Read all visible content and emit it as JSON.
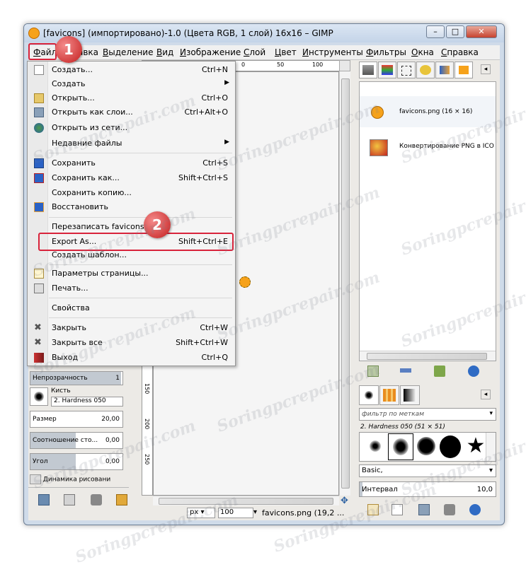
{
  "window": {
    "title": "[favicons] (импортировано)-1.0 (Цвета RGB, 1 слой) 16x16 – GIMP",
    "minimize": "–",
    "maximize": "□",
    "close": "✕"
  },
  "menubar": {
    "items": [
      {
        "label": "Файл",
        "u": "Ф",
        "rest": "айл"
      },
      {
        "label": "Правка",
        "u": "",
        "rest": "авка"
      },
      {
        "label": "Выделение",
        "u": "В",
        "rest": "ыделение"
      },
      {
        "label": "Вид",
        "u": "В",
        "rest": "ид"
      },
      {
        "label": "Изображение",
        "u": "И",
        "rest": "зображение"
      },
      {
        "label": "Слой",
        "u": "С",
        "rest": "лой"
      },
      {
        "label": "Цвет",
        "u": "Ц",
        "rest": "вет"
      },
      {
        "label": "Инструменты",
        "u": "И",
        "rest": "нструменты"
      },
      {
        "label": "Фильтры",
        "u": "Ф",
        "rest": "ильтры"
      },
      {
        "label": "Окна",
        "u": "О",
        "rest": "кна"
      },
      {
        "label": "Справка",
        "u": "С",
        "rest": "правка"
      }
    ]
  },
  "file_menu": {
    "items": [
      {
        "label": "Создать...",
        "shortcut": "Ctrl+N"
      },
      {
        "label": "Создать",
        "shortcut": ""
      },
      {
        "label": "Открыть...",
        "shortcut": "Ctrl+O"
      },
      {
        "label": "Открыть как слои...",
        "shortcut": "Ctrl+Alt+O"
      },
      {
        "label": "Открыть из сети...",
        "shortcut": ""
      },
      {
        "label": "Недавние файлы",
        "shortcut": ""
      },
      {
        "label": "Сохранить",
        "shortcut": "Ctrl+S"
      },
      {
        "label": "Сохранить как...",
        "shortcut": "Shift+Ctrl+S"
      },
      {
        "label": "Сохранить копию...",
        "shortcut": ""
      },
      {
        "label": "Восстановить",
        "shortcut": ""
      },
      {
        "label": "Перезаписать favicons.p",
        "shortcut": ""
      },
      {
        "label": "Export As...",
        "shortcut": "Shift+Ctrl+E"
      },
      {
        "label": "Создать шаблон...",
        "shortcut": ""
      },
      {
        "label": "Параметры страницы...",
        "shortcut": ""
      },
      {
        "label": "Печать...",
        "shortcut": ""
      },
      {
        "label": "Свойства",
        "shortcut": ""
      },
      {
        "label": "Закрыть",
        "shortcut": "Ctrl+W"
      },
      {
        "label": "Закрыть все",
        "shortcut": "Shift+Ctrl+W"
      },
      {
        "label": "Выход",
        "shortcut": "Ctrl+Q"
      }
    ]
  },
  "badges": {
    "one": "1",
    "two": "2"
  },
  "rulers": {
    "top": [
      "0",
      "50",
      "100"
    ],
    "left": [
      "150",
      "200",
      "250"
    ]
  },
  "tool_options": {
    "opacity_label": "Непрозрачность",
    "opacity_value": "1",
    "brush_label": "Кисть",
    "brush_value": "2. Hardness 050",
    "size_label": "Размер",
    "size_value": "20,00",
    "ratio_label": "Соотношение сто...",
    "ratio_value": "0,00",
    "angle_label": "Угол",
    "angle_value": "0,00",
    "dynamics_label": "Динамика рисовани"
  },
  "statusbar": {
    "unit": "px",
    "zoom": "100",
    "file_info": "favicons.png (19,2 ..."
  },
  "images_panel": {
    "items": [
      {
        "name": "favicons.png (16 × 16)"
      },
      {
        "name": "Конвертирование PNG в ICO"
      }
    ]
  },
  "brushes_panel": {
    "filter_placeholder": "фильтр по меткам",
    "brush_title": "2. Hardness 050 (51 × 51)",
    "preset": "Basic,",
    "interval_label": "Интервал",
    "interval_value": "10,0"
  },
  "watermark": "Soringpcrepair.com",
  "colors": {
    "highlight": "#d8233b",
    "accent": "#f6a21b"
  }
}
